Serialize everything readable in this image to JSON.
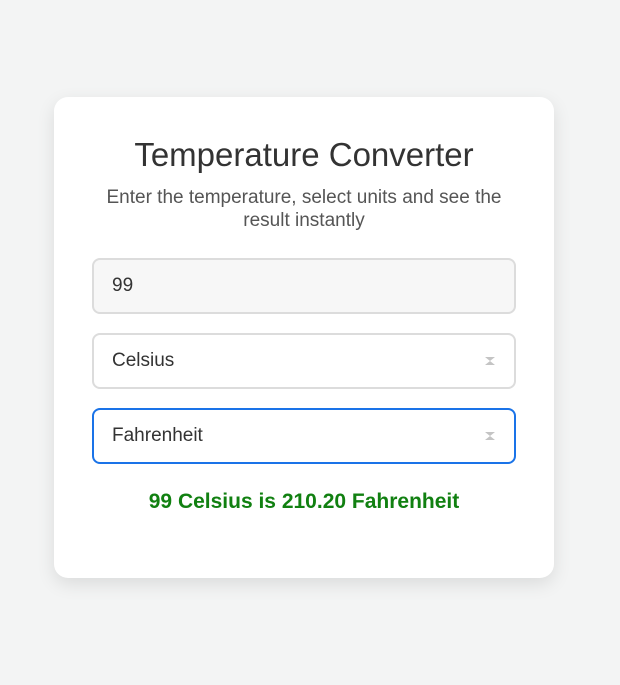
{
  "converter": {
    "title": "Temperature Converter",
    "subtitle": "Enter the temperature, select units and see the result instantly",
    "input_value": "99",
    "from_unit": "Celsius",
    "to_unit": "Fahrenheit",
    "result_text": "99 Celsius is 210.20 Fahrenheit",
    "icons": {
      "from_select_icon": "select-arrows-icon",
      "to_select_icon": "select-arrows-icon"
    },
    "colors": {
      "result": "#118011",
      "focus_border": "#1a73e8",
      "background": "#f3f4f4"
    }
  }
}
